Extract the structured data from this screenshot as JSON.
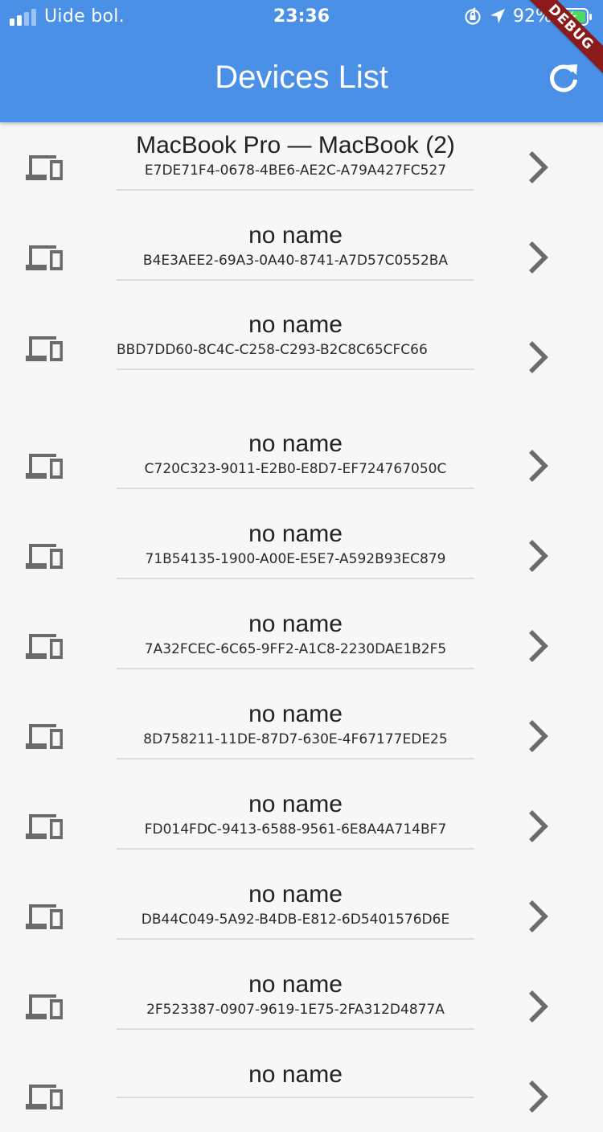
{
  "status_bar": {
    "carrier": "Uide bol.",
    "time": "23:36",
    "battery_percent": "92%",
    "icons": [
      "signal-icon",
      "orientation-lock-icon",
      "location-arrow-icon",
      "battery-charging-icon"
    ],
    "battery_color": "#4cd964"
  },
  "debug_banner": "DEBUG",
  "app_bar": {
    "title": "Devices List",
    "background_color": "#4a90e7",
    "action_icon": "refresh-icon"
  },
  "devices": [
    {
      "name": "MacBook Pro — MacBook (2)",
      "id": "E7DE71F4-0678-4BE6-AE2C-A79A427FC527"
    },
    {
      "name": "no name",
      "id": "B4E3AEE2-69A3-0A40-8741-A7D57C0552BA"
    },
    {
      "name": "no name",
      "id": "BBD7DD60-8C4C-C258-C293-B2C8C65CFC66"
    },
    {
      "name": "no name",
      "id": "C720C323-9011-E2B0-E8D7-EF724767050C"
    },
    {
      "name": "no name",
      "id": "71B54135-1900-A00E-E5E7-A592B93EC879"
    },
    {
      "name": "no name",
      "id": "7A32FCEC-6C65-9FF2-A1C8-2230DAE1B2F5"
    },
    {
      "name": "no name",
      "id": "8D758211-11DE-87D7-630E-4F67177EDE25"
    },
    {
      "name": "no name",
      "id": "FD014FDC-9413-6588-9561-6E8A4A714BF7"
    },
    {
      "name": "no name",
      "id": "DB44C049-5A92-B4DB-E812-6D5401576D6E"
    },
    {
      "name": "no name",
      "id": "2F523387-0907-9619-1E75-2FA312D4877A"
    },
    {
      "name": "no name",
      "id": ""
    }
  ],
  "list_icons": {
    "leading": "devices-icon",
    "trailing": "chevron-right-icon"
  }
}
